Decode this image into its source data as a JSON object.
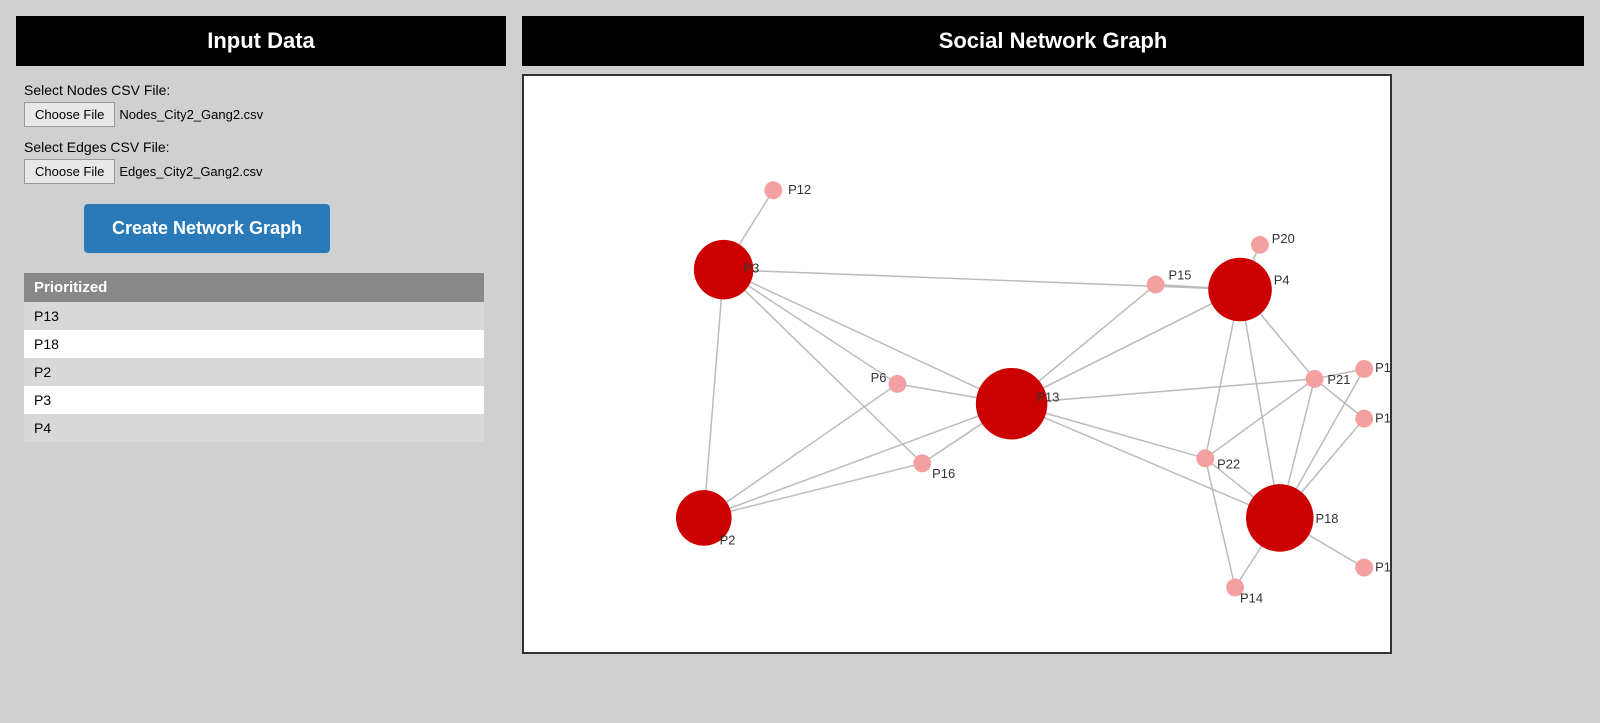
{
  "left_panel": {
    "header": "Input Data",
    "nodes_label": "Select Nodes CSV File:",
    "nodes_btn": "Choose File",
    "nodes_file": "Nodes_City2_Gang2.csv",
    "edges_label": "Select Edges CSV File:",
    "edges_btn": "Choose File",
    "edges_file": "Edges_City2_Gang2.csv",
    "create_btn": "Create Network Graph",
    "prioritized_header": "Prioritized",
    "prioritized_list": [
      "P13",
      "P18",
      "P2",
      "P3",
      "P4"
    ]
  },
  "right_panel": {
    "header": "Social Network Graph"
  }
}
